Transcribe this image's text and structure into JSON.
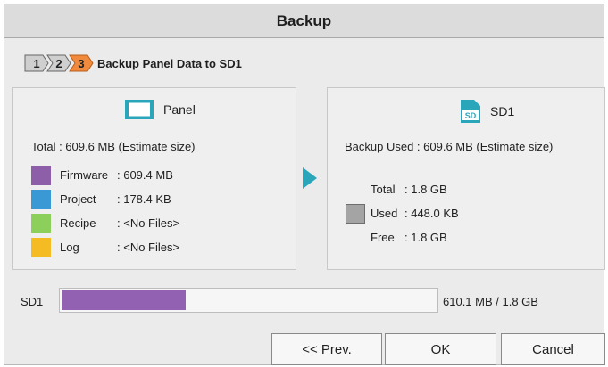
{
  "window": {
    "title": "Backup"
  },
  "steps": {
    "labels": [
      "1",
      "2",
      "3"
    ],
    "current": 3,
    "title": "Backup Panel Data to SD1"
  },
  "panel": {
    "label": "Panel",
    "total": "Total : 609.6 MB (Estimate size)",
    "items": [
      {
        "name": "Firmware",
        "value": ": 609.4 MB",
        "color": "#8d5fa9"
      },
      {
        "name": "Project",
        "value": ": 178.4 KB",
        "color": "#3899d5"
      },
      {
        "name": "Recipe",
        "value": ": <No Files>",
        "color": "#8ccf5a"
      },
      {
        "name": "Log",
        "value": ": <No Files>",
        "color": "#f5bb22"
      }
    ]
  },
  "sd": {
    "label": "SD1",
    "icon_text": "SD",
    "backup_used": "Backup Used : 609.6 MB (Estimate size)",
    "stats": [
      {
        "name": "Total",
        "value": ": 1.8 GB"
      },
      {
        "name": "Used",
        "value": ": 448.0 KB"
      },
      {
        "name": "Free",
        "value": ": 1.8 GB"
      }
    ]
  },
  "usage_bar": {
    "label": "SD1",
    "text": "610.1 MB / 1.8 GB",
    "fraction": 0.331
  },
  "buttons": {
    "prev": "<< Prev.",
    "ok": "OK",
    "cancel": "Cancel"
  },
  "colors": {
    "accent": "#2aa6bb",
    "step_active": "#f08a3c",
    "step_inactive": "#cfcfcf",
    "bar_fill": "#9361b2"
  }
}
